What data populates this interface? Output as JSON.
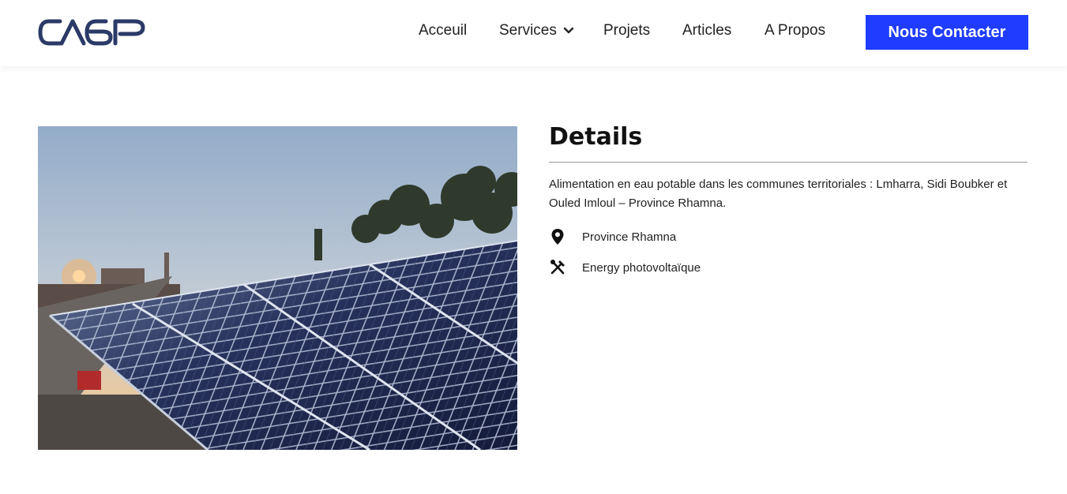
{
  "header": {
    "logo_text": "CAGP",
    "nav": [
      {
        "label": "Acceuil"
      },
      {
        "label": "Services",
        "has_dropdown": true
      },
      {
        "label": "Projets"
      },
      {
        "label": "Articles"
      },
      {
        "label": "A Propos"
      }
    ],
    "cta_label": "Nous Contacter",
    "cta_color": "#1f3cff",
    "logo_color": "#2b3a67"
  },
  "project": {
    "image_subject": "solar-panels-photo",
    "details_title": "Details",
    "description": "Alimentation en eau potable dans les communes territoriales : Lmharra, Sidi Boubker et Ouled Imloul – Province Rhamna.",
    "location": "Province Rhamna",
    "category": "Energy photovoltaïque",
    "location_icon": "map-pin-icon",
    "category_icon": "tools-icon"
  }
}
